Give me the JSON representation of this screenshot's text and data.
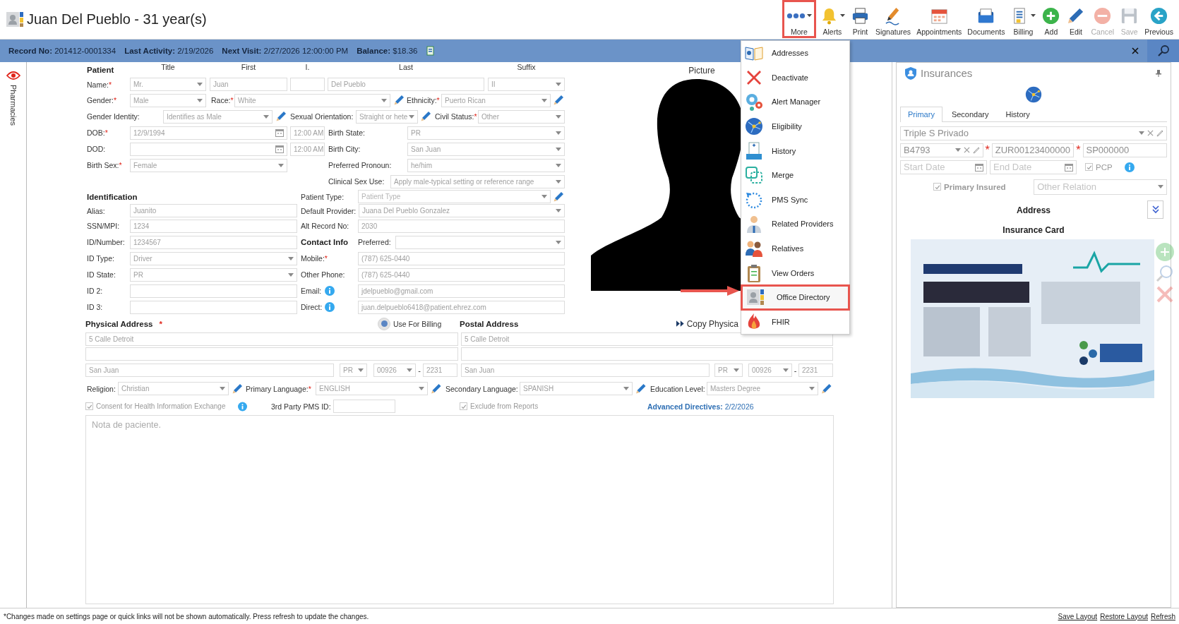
{
  "header": {
    "title": "Juan Del Pueblo - 31 year(s)"
  },
  "toolbar": [
    {
      "label": "More",
      "caret": true,
      "highlighted": true,
      "disabled": false
    },
    {
      "label": "Alerts",
      "caret": true,
      "highlighted": false,
      "disabled": false
    },
    {
      "label": "Print",
      "caret": false,
      "highlighted": false,
      "disabled": false
    },
    {
      "label": "Signatures",
      "caret": false,
      "highlighted": false,
      "disabled": false
    },
    {
      "label": "Appointments",
      "caret": false,
      "highlighted": false,
      "disabled": false
    },
    {
      "label": "Documents",
      "caret": false,
      "highlighted": false,
      "disabled": false
    },
    {
      "label": "Billing",
      "caret": true,
      "highlighted": false,
      "disabled": false
    },
    {
      "label": "Add",
      "caret": false,
      "highlighted": false,
      "disabled": false
    },
    {
      "label": "Edit",
      "caret": false,
      "highlighted": false,
      "disabled": false
    },
    {
      "label": "Cancel",
      "caret": false,
      "highlighted": false,
      "disabled": true
    },
    {
      "label": "Save",
      "caret": false,
      "highlighted": false,
      "disabled": true
    },
    {
      "label": "Previous",
      "caret": false,
      "highlighted": false,
      "disabled": false
    }
  ],
  "info_bar": {
    "items": [
      {
        "label": "Record No:",
        "value": "201412-0001334"
      },
      {
        "label": "Last Activity:",
        "value": "2/19/2026"
      },
      {
        "label": "Next Visit:",
        "value": "2/27/2026 12:00:00 PM"
      },
      {
        "label": "Balance:",
        "value": "$18.36"
      }
    ]
  },
  "side_panel": {
    "tab": "Pharmacies"
  },
  "form": {
    "rows": [
      {
        "items": [
          {
            "kind": "heading",
            "text": "Patient"
          },
          {
            "kind": "column",
            "text": "Title"
          },
          {
            "kind": "column",
            "text": "First"
          },
          {
            "kind": "column",
            "text": "I."
          },
          {
            "kind": "column",
            "text": "Last"
          },
          {
            "kind": "column",
            "text": "Suffix"
          }
        ]
      },
      {
        "items": [
          {
            "kind": "label",
            "text": "Name:",
            "mark": "*"
          },
          {
            "kind": "select",
            "value": "Mr."
          },
          {
            "kind": "text",
            "value": "Juan"
          },
          {
            "kind": "text"
          },
          {
            "kind": "text",
            "value": "Del Pueblo"
          },
          {
            "kind": "select",
            "value": "II"
          }
        ]
      },
      {
        "items": [
          {
            "kind": "label",
            "text": "Gender:",
            "mark": "*"
          },
          {
            "kind": "select",
            "value": "Male"
          },
          {
            "kind": "label",
            "text": "Race:",
            "mark": "*"
          },
          {
            "kind": "select",
            "value": "White"
          },
          {
            "kind": "edit"
          },
          {
            "kind": "label",
            "text": "Ethnicity:",
            "mark": "*"
          },
          {
            "kind": "select",
            "value": "Puerto Rican"
          },
          {
            "kind": "edit"
          }
        ]
      },
      {
        "items": [
          {
            "kind": "label",
            "text": "Gender Identity:"
          },
          {
            "kind": "select",
            "value": "Identifies as Male"
          },
          {
            "kind": "edit"
          },
          {
            "kind": "label",
            "text": "Sexual Orientation:"
          },
          {
            "kind": "select",
            "value": "Straight or hete"
          },
          {
            "kind": "edit"
          },
          {
            "kind": "label",
            "text": "Civil Status:",
            "mark": "*"
          },
          {
            "kind": "select",
            "value": "Other"
          }
        ]
      },
      {
        "items": [
          {
            "kind": "label",
            "text": "DOB:",
            "mark": "*"
          },
          {
            "kind": "date",
            "value": "12/9/1994"
          },
          {
            "kind": "time",
            "value": "12:00 AM"
          },
          {
            "kind": "label",
            "text": "Birth State:"
          },
          {
            "kind": "select",
            "value": "PR"
          }
        ]
      },
      {
        "items": [
          {
            "kind": "label",
            "text": "DOD:"
          },
          {
            "kind": "date"
          },
          {
            "kind": "time",
            "value": "12:00 AM"
          },
          {
            "kind": "label",
            "text": "Birth City:"
          },
          {
            "kind": "select",
            "value": "San Juan"
          }
        ]
      },
      {
        "items": [
          {
            "kind": "label",
            "text": "Birth Sex:",
            "mark": "*"
          },
          {
            "kind": "select",
            "value": "Female"
          },
          {
            "kind": "label",
            "text": "Preferred Pronoun:"
          },
          {
            "kind": "select",
            "value": "he/him"
          }
        ]
      },
      {
        "items": [
          {
            "kind": "label",
            "text": "Clinical Sex Use:"
          },
          {
            "kind": "select",
            "value": "Apply male-typical setting or reference range"
          }
        ]
      },
      {
        "items": [
          {
            "kind": "heading",
            "text": "Identification"
          },
          {
            "kind": "label",
            "text": "Patient Type:"
          },
          {
            "kind": "select",
            "placeholder": "Patient Type"
          },
          {
            "kind": "edit"
          }
        ]
      },
      {
        "items": [
          {
            "kind": "label",
            "text": "Alias:"
          },
          {
            "kind": "text",
            "value": "Juanito"
          },
          {
            "kind": "label",
            "text": "Default Provider:"
          },
          {
            "kind": "select",
            "value": "Juana Del Pueblo Gonzalez"
          }
        ]
      },
      {
        "items": [
          {
            "kind": "label",
            "text": "SSN/MPI:"
          },
          {
            "kind": "text",
            "value": "1234"
          },
          {
            "kind": "label",
            "text": "Alt Record No:"
          },
          {
            "kind": "text",
            "value": "2030"
          }
        ]
      },
      {
        "items": [
          {
            "kind": "label",
            "text": "ID/Number:"
          },
          {
            "kind": "text",
            "value": "1234567"
          },
          {
            "kind": "heading",
            "text": "Contact Info"
          },
          {
            "kind": "label",
            "text": "Preferred:"
          },
          {
            "kind": "select"
          }
        ]
      },
      {
        "items": [
          {
            "kind": "label",
            "text": "ID Type:"
          },
          {
            "kind": "select",
            "value": "Driver"
          },
          {
            "kind": "label",
            "text": "Mobile:",
            "mark": "*"
          },
          {
            "kind": "text",
            "value": "(787) 625-0440"
          }
        ]
      },
      {
        "items": [
          {
            "kind": "label",
            "text": "ID State:"
          },
          {
            "kind": "select",
            "value": "PR"
          },
          {
            "kind": "label",
            "text": "Other Phone:"
          },
          {
            "kind": "text",
            "value": "(787) 625-0440"
          }
        ]
      },
      {
        "items": [
          {
            "kind": "label",
            "text": "ID 2:"
          },
          {
            "kind": "text"
          },
          {
            "kind": "label",
            "text": "Email:"
          },
          {
            "kind": "info"
          },
          {
            "kind": "text",
            "value": "jdelpueblo@gmail.com"
          }
        ]
      },
      {
        "items": [
          {
            "kind": "label",
            "text": "ID 3:"
          },
          {
            "kind": "text"
          },
          {
            "kind": "label",
            "text": "Direct:"
          },
          {
            "kind": "info"
          },
          {
            "kind": "text",
            "value": "juan.delpueblo6418@patient.ehrez.com"
          }
        ]
      }
    ]
  },
  "picture": {
    "label": "Picture"
  },
  "address_section": {
    "rows": [
      {
        "items": [
          {
            "kind": "heading",
            "text": "Physical Address",
            "mark": "*"
          },
          {
            "kind": "radio",
            "label": "Use For Billing",
            "selected": true
          },
          {
            "kind": "heading",
            "text": "Postal Address"
          },
          {
            "kind": "copy",
            "text": "Copy Physica"
          }
        ]
      },
      {
        "items": [
          {
            "kind": "text",
            "value": "5 Calle Detroit"
          },
          {
            "kind": "text",
            "value": "5 Calle Detroit"
          }
        ]
      },
      {
        "items": [
          {
            "kind": "text"
          },
          {
            "kind": "text"
          }
        ]
      },
      {
        "items": [
          {
            "kind": "text",
            "value": "San Juan"
          },
          {
            "kind": "select",
            "value": "PR"
          },
          {
            "kind": "select",
            "value": "00926"
          },
          {
            "kind": "dash",
            "text": "-"
          },
          {
            "kind": "text",
            "value": "2231"
          },
          {
            "kind": "text",
            "value": "San Juan"
          },
          {
            "kind": "select",
            "value": "PR"
          },
          {
            "kind": "select",
            "value": "00926"
          },
          {
            "kind": "dash",
            "text": "-"
          },
          {
            "kind": "text",
            "value": "2231"
          }
        ]
      },
      {
        "items": [
          {
            "kind": "label",
            "text": "Religion:"
          },
          {
            "kind": "select",
            "value": "Christian"
          },
          {
            "kind": "edit"
          },
          {
            "kind": "label",
            "text": "Primary Language:",
            "mark": "*"
          },
          {
            "kind": "select",
            "value": "ENGLISH"
          },
          {
            "kind": "edit"
          },
          {
            "kind": "label",
            "text": "Secondary Language:"
          },
          {
            "kind": "select",
            "value": "SPANISH"
          },
          {
            "kind": "edit"
          },
          {
            "kind": "label",
            "text": "Education Level:"
          },
          {
            "kind": "select",
            "value": "Masters Degree"
          },
          {
            "kind": "edit"
          }
        ]
      },
      {
        "items": [
          {
            "kind": "checkbox",
            "label": "Consent for Health Information Exchange",
            "checked": true
          },
          {
            "kind": "info"
          },
          {
            "kind": "label",
            "text": "3rd Party PMS ID:"
          },
          {
            "kind": "text"
          },
          {
            "kind": "checkbox",
            "label": "Exclude from Reports",
            "checked": true
          },
          {
            "kind": "link",
            "text": "**Advanced Directives:** 2/2/2026"
          }
        ]
      }
    ]
  },
  "notes": {
    "placeholder": "Nota de paciente."
  },
  "more_menu": {
    "items": [
      {
        "label": "Addresses",
        "highlighted": false
      },
      {
        "label": "Deactivate",
        "highlighted": false
      },
      {
        "label": "Alert Manager",
        "highlighted": false
      },
      {
        "label": "Eligibility",
        "highlighted": false
      },
      {
        "label": "History",
        "highlighted": false
      },
      {
        "label": "Merge",
        "highlighted": false
      },
      {
        "label": "PMS Sync",
        "highlighted": false
      },
      {
        "label": "Related Providers",
        "highlighted": false
      },
      {
        "label": "Relatives",
        "highlighted": false
      },
      {
        "label": "View Orders",
        "highlighted": false
      },
      {
        "label": "Office Directory",
        "highlighted": true
      },
      {
        "label": "FHIR",
        "highlighted": false
      }
    ]
  },
  "insurance": {
    "title": "Insurances",
    "tabs": [
      {
        "label": "Primary",
        "selected": true
      },
      {
        "label": "Secondary",
        "selected": false
      },
      {
        "label": "History",
        "selected": false
      }
    ],
    "plan": {
      "value": "Triple S Privado"
    },
    "group": {
      "value": "B4793"
    },
    "member_id": {
      "mark": "*",
      "value": "ZUR00123400000"
    },
    "second_id": {
      "mark": "*",
      "value": "SP000000"
    },
    "start_date": {
      "placeholder": "Start Date"
    },
    "end_date": {
      "placeholder": "End Date"
    },
    "pcp": {
      "label": "PCP",
      "checked": true
    },
    "primary_insured": {
      "label": "Primary Insured",
      "checked": true
    },
    "relation": {
      "placeholder": "Other Relation"
    },
    "address_label": "Address",
    "card_label": "Insurance Card"
  },
  "footer": {
    "note": "*Changes made on settings page or quick links will not be shown automatically. Press refresh to update the changes.",
    "links": [
      "Save Layout",
      "Restore Layout",
      "Refresh"
    ]
  }
}
